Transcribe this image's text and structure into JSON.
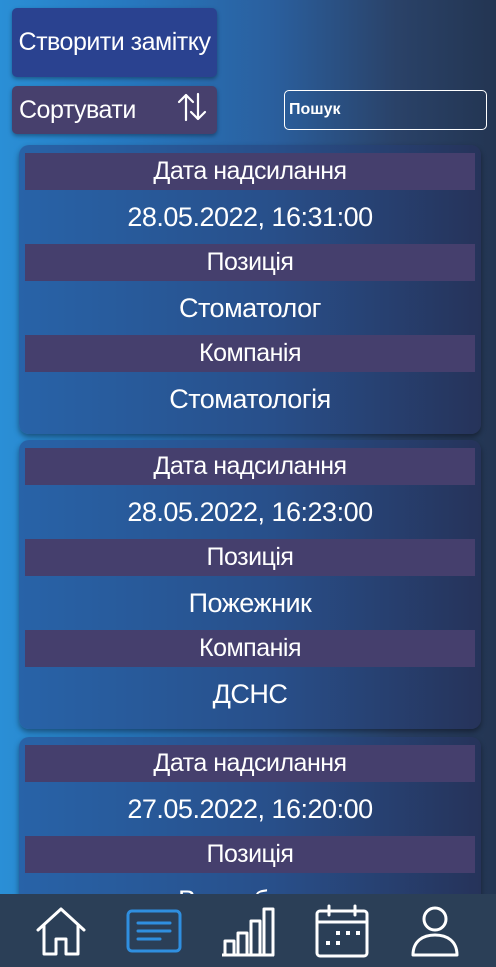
{
  "toolbar": {
    "create_label": "Створити замітку",
    "sort_label": "Сортувати",
    "search_placeholder": "Пошук"
  },
  "notes": [
    {
      "date_label": "Дата надсилання",
      "date": "28.05.2022, 16:31:00",
      "position_label": "Позиція",
      "position": "Стоматолог",
      "company_label": "Компанія",
      "company": "Стоматологія"
    },
    {
      "date_label": "Дата надсилання",
      "date": "28.05.2022, 16:23:00",
      "position_label": "Позиція",
      "position": "Пожежник",
      "company_label": "Компанія",
      "company": "ДСНС"
    },
    {
      "date_label": "Дата надсилання",
      "date": "27.05.2022, 16:20:00",
      "position_label": "Позиція",
      "position": "Випробувач"
    }
  ],
  "nav": {
    "items": [
      "home-icon",
      "notes-icon",
      "stats-icon",
      "calendar-icon",
      "profile-icon"
    ],
    "active": "notes-icon",
    "active_color": "#2f8fe0"
  }
}
